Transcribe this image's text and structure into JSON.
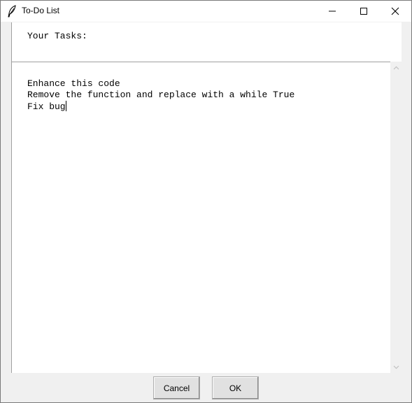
{
  "window": {
    "title": "To-Do List",
    "icon": "feather-icon"
  },
  "title_controls": {
    "minimize": "minimize-icon",
    "maximize": "maximize-icon",
    "close": "close-icon"
  },
  "header": {
    "label": "Your Tasks:"
  },
  "tasks": {
    "lines": [
      "Enhance this code",
      "Remove the function and replace with a while True",
      "Fix bug"
    ]
  },
  "buttons": {
    "cancel_label": "Cancel",
    "ok_label": "OK"
  },
  "colors": {
    "background": "#f0f0f0",
    "panel": "#ffffff",
    "button_face": "#e1e1e1"
  }
}
